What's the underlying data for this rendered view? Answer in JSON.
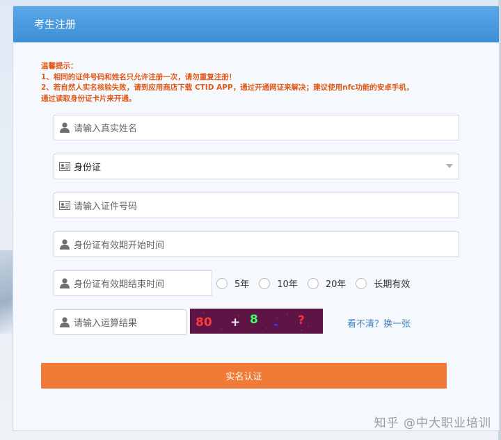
{
  "header": {
    "title": "考生注册"
  },
  "notice": {
    "title": "温馨提示：",
    "line1": "1、相同的证件号码和姓名只允许注册一次，请勿重复注册！",
    "line2": "2、若自然人实名核验失败，请到应用商店下载 CTID APP，通过开通网证来解决；建议使用nfc功能的安卓手机，",
    "line3": "通过读取身份证卡片来开通。"
  },
  "form": {
    "name_placeholder": "请输入真实姓名",
    "id_type_selected": "身份证",
    "id_number_placeholder": "请输入证件号码",
    "valid_start_placeholder": "身份证有效期开始时间",
    "valid_end_placeholder": "身份证有效期结束时间",
    "validity_options": [
      "5年",
      "10年",
      "20年",
      "长期有效"
    ],
    "captcha_placeholder": "请输入运算结果",
    "captcha_text": [
      "80",
      "+",
      "8",
      "-",
      "?"
    ],
    "refresh_label": "看不清？换一张",
    "submit_label": "实名认证"
  },
  "watermark": "知乎 @中大职业培训",
  "colors": {
    "header": "#3d8fd8",
    "notice": "#e05a1a",
    "submit": "#f07a36",
    "link": "#3f7fbe"
  }
}
